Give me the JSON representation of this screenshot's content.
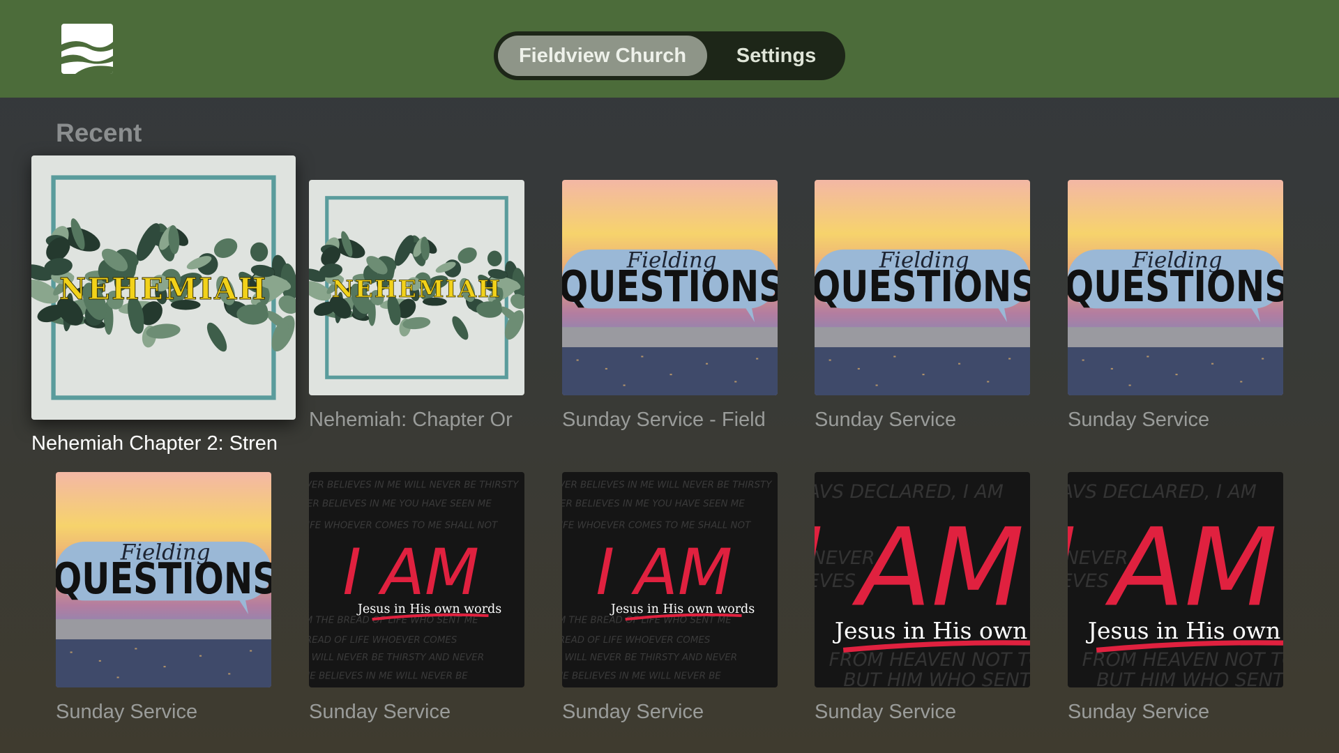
{
  "header": {
    "logo_icon": "fieldview-logo-icon",
    "tabs": [
      {
        "label": "Fieldview Church",
        "active": true
      },
      {
        "label": "Settings",
        "active": false
      }
    ]
  },
  "recent": {
    "title": "Recent",
    "items": [
      {
        "title": "Nehemiah Chapter 2: Stren",
        "artwork": "nehemiah",
        "artwork_text": "NEHEMIAH"
      },
      {
        "title": "Nehemiah: Chapter Or",
        "artwork": "nehemiah",
        "artwork_text": "NEHEMIAH"
      },
      {
        "title": "Sunday Service - Field",
        "artwork": "fielding-questions",
        "artwork_text": [
          "Fielding",
          "QUESTIONS"
        ]
      },
      {
        "title": "Sunday Service",
        "artwork": "fielding-questions",
        "artwork_text": [
          "Fielding",
          "QUESTIONS"
        ]
      },
      {
        "title": "Sunday Service",
        "artwork": "fielding-questions",
        "artwork_text": [
          "Fielding",
          "QUESTIONS"
        ]
      },
      {
        "title": "Sunday Service",
        "artwork": "fielding-questions",
        "artwork_text": [
          "Fielding",
          "QUESTIONS"
        ]
      },
      {
        "title": "Sunday Service",
        "artwork": "i-am",
        "artwork_text": [
          "I AM",
          "Jesus in His own words"
        ]
      },
      {
        "title": "Sunday Service",
        "artwork": "i-am",
        "artwork_text": [
          "I AM",
          "Jesus in His own words"
        ]
      },
      {
        "title": "Sunday Service",
        "artwork": "i-am-zoomed",
        "artwork_text": [
          "I AM",
          "Jesus in His own wo"
        ]
      },
      {
        "title": "Sunday Service",
        "artwork": "i-am-zoomed",
        "artwork_text": [
          "I AM",
          "Jesus in His own wo"
        ]
      }
    ]
  },
  "colors": {
    "header_bg": "#4c6c3a",
    "tab_active_bg": "#8e9588",
    "tab_bar_bg": "#1d2618",
    "accent_red": "#e0213f",
    "nehemiah_frame": "#5a9c9c",
    "nehemiah_text": "#f2d21a",
    "fq_bubble": "#9ab8d6"
  }
}
